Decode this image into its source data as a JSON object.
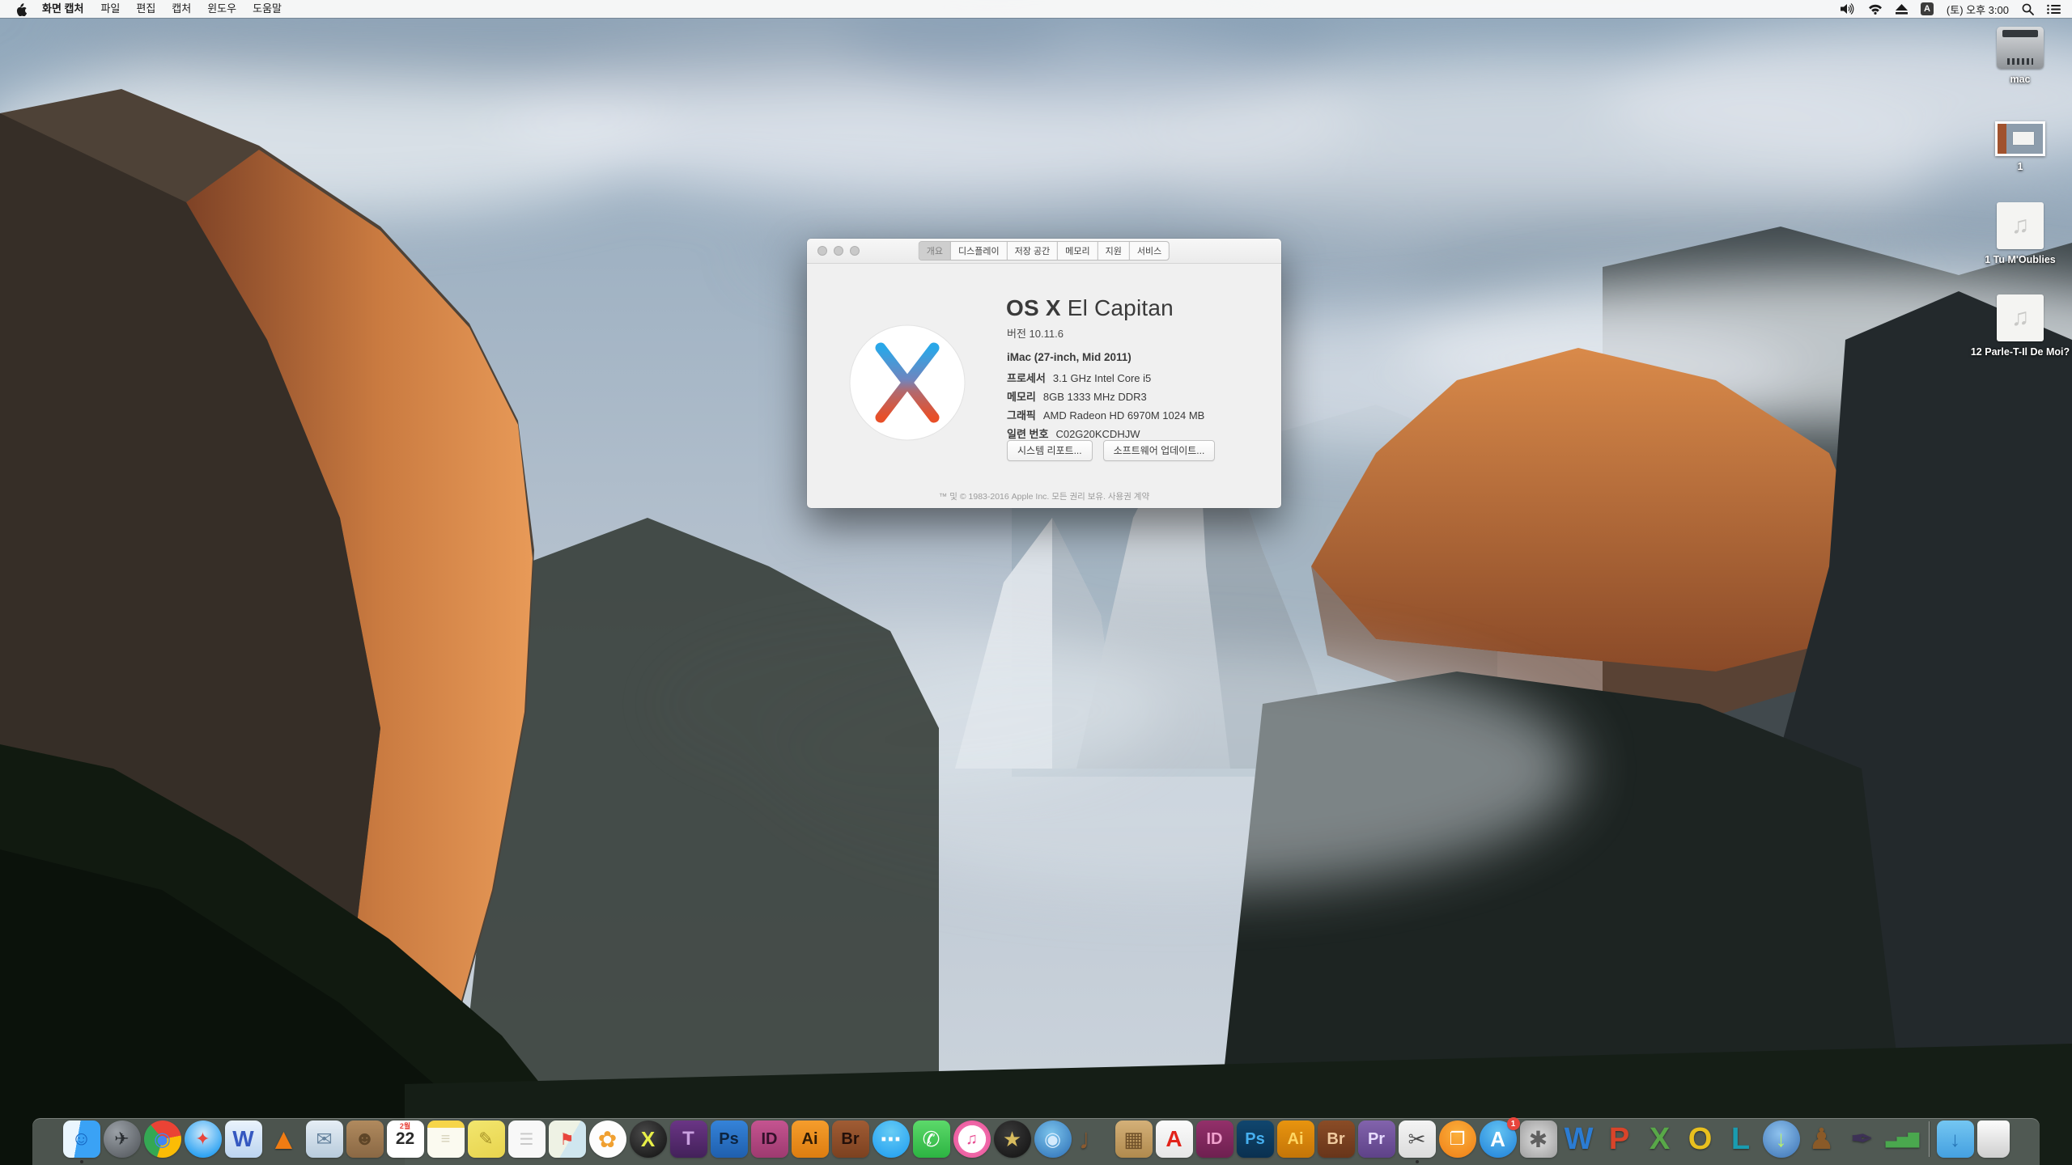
{
  "menu_bar": {
    "apple_icon": "apple-logo",
    "items": [
      {
        "id": "app",
        "label": "화면 캡처",
        "bold": true
      },
      {
        "id": "file",
        "label": "파일"
      },
      {
        "id": "edit",
        "label": "편집"
      },
      {
        "id": "capture",
        "label": "캡처"
      },
      {
        "id": "window",
        "label": "윈도우"
      },
      {
        "id": "help",
        "label": "도움말"
      }
    ],
    "status_icons_left": [
      "volume",
      "wifi",
      "eject"
    ],
    "input_source": "A",
    "clock": "(토) 오후 3:00",
    "status_icons_right": [
      "spotlight",
      "notification-center"
    ]
  },
  "about_window": {
    "tabs": [
      {
        "label": "개요",
        "selected": true
      },
      {
        "label": "디스플레이",
        "selected": false
      },
      {
        "label": "저장 공간",
        "selected": false
      },
      {
        "label": "메모리",
        "selected": false
      },
      {
        "label": "지원",
        "selected": false
      },
      {
        "label": "서비스",
        "selected": false
      }
    ],
    "title_bold": "OS X",
    "title_rest": " El Capitan",
    "version": "버전 10.11.6",
    "model": "iMac (27-inch, Mid 2011)",
    "specs": [
      {
        "label": "프로세서",
        "value": "3.1 GHz Intel Core i5"
      },
      {
        "label": "메모리",
        "value": "8GB 1333 MHz DDR3"
      },
      {
        "label": "그래픽",
        "value": "AMD Radeon HD 6970M 1024 MB"
      },
      {
        "label": "일련 번호",
        "value": "C02G20KCDHJW"
      }
    ],
    "buttons": [
      {
        "id": "system-report",
        "label": "시스템 리포트..."
      },
      {
        "id": "software-update",
        "label": "소프트웨어 업데이트..."
      }
    ],
    "footer": "™ 및 © 1983-2016 Apple Inc. 모든 권리 보유. 사용권 계약",
    "logo": "os-x-el-capitan-logo"
  },
  "desktop_icons": [
    {
      "name": "hard-drive-mac",
      "label": "mac",
      "type": "drive"
    },
    {
      "name": "screenshot-file-1",
      "label": "1",
      "type": "image"
    },
    {
      "name": "audio-file-tu-moublies",
      "label": "1 Tu M'Oublies",
      "type": "audio"
    },
    {
      "name": "audio-file-parle-t-il",
      "label": "12 Parle-T-Il De Moi?",
      "type": "audio"
    }
  ],
  "dock": {
    "items": [
      {
        "name": "finder",
        "glyph": "☺",
        "fg": "#1565c0",
        "bg": "linear-gradient(100deg,#eaf6fe 0 40%,#3aa2f5 40%)",
        "shape": "rounded",
        "fs": 24,
        "running": true
      },
      {
        "name": "launchpad",
        "glyph": "✈",
        "fg": "#2b2f33",
        "bg": "radial-gradient(circle at 35% 30%,#9aa0a6,#4d5156)",
        "shape": "circle",
        "fs": 22
      },
      {
        "name": "chrome",
        "glyph": "◉",
        "fg": "#4285f4",
        "bg": "conic-gradient(from -40deg,#ea4335 0 33%,#fbbc05 0 66%,#34a853 0)",
        "shape": "circle",
        "fs": 24
      },
      {
        "name": "safari",
        "glyph": "✦",
        "fg": "#e8453c",
        "bg": "radial-gradient(circle at 50% 35%,#cfeafc,#2fa3f2 75%)",
        "shape": "circle",
        "fs": 22
      },
      {
        "name": "iweb",
        "glyph": "W",
        "fg": "#3558c0",
        "bg": "linear-gradient(180deg,#eaf3fc,#bcd4f0)",
        "shape": "rounded",
        "fs": 28
      },
      {
        "name": "vlc",
        "glyph": "▲",
        "fg": "#f07c13",
        "bg": "transparent",
        "shape": "plain",
        "fs": 36
      },
      {
        "name": "mail",
        "glyph": "✉",
        "fg": "#64819c",
        "bg": "linear-gradient(180deg,#e6eef5,#b8cbdc)",
        "shape": "rounded",
        "fs": 24
      },
      {
        "name": "contacts",
        "glyph": "☻",
        "fg": "#5f4628",
        "bg": "linear-gradient(180deg,#b08a5e,#8a6844)",
        "shape": "rounded",
        "fs": 24
      },
      {
        "name": "calendar",
        "glyph": "22",
        "fg": "#2b2b2b",
        "bg": "#ffffff",
        "shape": "rounded",
        "fs": 21,
        "top": "2월"
      },
      {
        "name": "notes",
        "glyph": "≡",
        "fg": "#d6d2ba",
        "bg": "linear-gradient(180deg,#f6d54a 0 20%,#fbfaf0 20%)",
        "shape": "rounded",
        "fs": 20
      },
      {
        "name": "stickies",
        "glyph": "✎",
        "fg": "#a89428",
        "bg": "linear-gradient(160deg,#f2e66e,#e8d44e)",
        "shape": "rounded",
        "fs": 22
      },
      {
        "name": "reminders",
        "glyph": "☰",
        "fg": "#c9c9c9",
        "bg": "#f8f8f8",
        "shape": "rounded",
        "fs": 20
      },
      {
        "name": "maps",
        "glyph": "⚑",
        "fg": "#e8453c",
        "bg": "linear-gradient(120deg,#eef2e4 0 55%,#cfe6ef 55%)",
        "shape": "rounded",
        "fs": 20
      },
      {
        "name": "photos",
        "glyph": "✿",
        "fg": "#f0a030",
        "bg": "#fdfdfd",
        "shape": "circle",
        "fs": 28
      },
      {
        "name": "quarkxpress",
        "glyph": "X",
        "fg": "#e8f048",
        "bg": "radial-gradient(circle at 40% 35%,#4a4a4a,#0e0e0e)",
        "shape": "circle",
        "fs": 26
      },
      {
        "name": "toast-titanium",
        "glyph": "T",
        "fg": "#c9a0e0",
        "bg": "linear-gradient(180deg,#6a3585,#43215a)",
        "shape": "rounded",
        "fs": 24
      },
      {
        "name": "photoshop-cs5",
        "glyph": "Ps",
        "fg": "#0d2440",
        "bg": "linear-gradient(180deg,#3583d8,#1f5fae)",
        "shape": "rounded",
        "fs": 20
      },
      {
        "name": "indesign-cs5",
        "glyph": "ID",
        "fg": "#33102a",
        "bg": "linear-gradient(180deg,#c45490,#9e3a70)",
        "shape": "rounded",
        "fs": 20
      },
      {
        "name": "illustrator-cs5",
        "glyph": "Ai",
        "fg": "#301c05",
        "bg": "linear-gradient(180deg,#f59d2c,#dd7d10)",
        "shape": "rounded",
        "fs": 20
      },
      {
        "name": "bridge-cs5",
        "glyph": "Br",
        "fg": "#23100a",
        "bg": "linear-gradient(180deg,#a05c34,#7c4120)",
        "shape": "rounded",
        "fs": 20
      },
      {
        "name": "messages",
        "glyph": "⋯",
        "fg": "#ffffff",
        "bg": "radial-gradient(circle at 50% 30%,#66ccf5,#1d9bf0)",
        "shape": "circle",
        "fs": 26
      },
      {
        "name": "facetime",
        "glyph": "✆",
        "fg": "#ffffff",
        "bg": "linear-gradient(180deg,#5cd96a,#2cb442)",
        "shape": "rounded",
        "fs": 26
      },
      {
        "name": "itunes",
        "glyph": "♫",
        "fg": "#e84a90",
        "bg": "radial-gradient(circle,#ffffff 52%,#f06aaa 53%,#e84a90)",
        "shape": "circle",
        "fs": 20
      },
      {
        "name": "imovie",
        "glyph": "★",
        "fg": "#d8bc5e",
        "bg": "radial-gradient(circle at 40% 35%,#3a3a3a,#101010)",
        "shape": "circle",
        "fs": 26
      },
      {
        "name": "dvd-player",
        "glyph": "◉",
        "fg": "#d5eafc",
        "bg": "radial-gradient(circle at 45% 35%,#7cc4ec,#2a6cb4)",
        "shape": "circle",
        "fs": 24
      },
      {
        "name": "garageband",
        "glyph": "♩",
        "fg": "#8a5a30",
        "bg": "transparent",
        "shape": "plain",
        "fs": 36
      },
      {
        "name": "photo-board",
        "glyph": "▦",
        "fg": "#6e4f28",
        "bg": "linear-gradient(180deg,#d4b078,#b08a4e)",
        "shape": "rounded",
        "fs": 26
      },
      {
        "name": "acrobat-reader",
        "glyph": "A",
        "fg": "#e2231a",
        "bg": "linear-gradient(180deg,#fbfbfb,#e6e6e6)",
        "shape": "rounded",
        "fs": 28
      },
      {
        "name": "indesign-cs6",
        "glyph": "ID",
        "fg": "#f0a0cc",
        "bg": "linear-gradient(180deg,#93306a,#6e2050)",
        "shape": "rounded",
        "fs": 20
      },
      {
        "name": "photoshop-cs6",
        "glyph": "Ps",
        "fg": "#46b0f0",
        "bg": "linear-gradient(180deg,#10466e,#0a3050)",
        "shape": "rounded",
        "fs": 20
      },
      {
        "name": "illustrator-cs6",
        "glyph": "Ai",
        "fg": "#ffd763",
        "bg": "linear-gradient(180deg,#e8940f,#c47508)",
        "shape": "rounded",
        "fs": 20
      },
      {
        "name": "bridge-cs6",
        "glyph": "Br",
        "fg": "#f0ca9e",
        "bg": "linear-gradient(180deg,#8a4c26,#68351a)",
        "shape": "rounded",
        "fs": 20
      },
      {
        "name": "premiere-cs6",
        "glyph": "Pr",
        "fg": "#e8dcff",
        "bg": "linear-gradient(180deg,#8263ac,#5e4288)",
        "shape": "rounded",
        "fs": 20
      },
      {
        "name": "grab-screen-capture",
        "glyph": "✂",
        "fg": "#4a4a4a",
        "bg": "linear-gradient(180deg,#f4f4f4,#dcdcdc)",
        "shape": "rounded",
        "fs": 26,
        "running": true
      },
      {
        "name": "ibooks",
        "glyph": "❐",
        "fg": "#ffffff",
        "bg": "radial-gradient(circle at 50% 35%,#fbb03c,#ef7d15)",
        "shape": "circle",
        "fs": 22
      },
      {
        "name": "app-store",
        "glyph": "A",
        "fg": "#ffffff",
        "bg": "radial-gradient(circle at 50% 30%,#62c2f2,#1f80d8)",
        "shape": "circle",
        "fs": 26,
        "badge": "1"
      },
      {
        "name": "system-preferences",
        "glyph": "✱",
        "fg": "#606060",
        "bg": "radial-gradient(circle,#e0e0e0,#9e9e9e)",
        "shape": "rounded",
        "fs": 28
      },
      {
        "name": "word-2011",
        "glyph": "W",
        "fg": "#2b7cd3",
        "bg": "transparent",
        "shape": "plain",
        "fs": 38
      },
      {
        "name": "powerpoint-2011",
        "glyph": "P",
        "fg": "#d8442a",
        "bg": "transparent",
        "shape": "plain",
        "fs": 38
      },
      {
        "name": "excel-2011",
        "glyph": "X",
        "fg": "#58a848",
        "bg": "transparent",
        "shape": "plain",
        "fs": 38
      },
      {
        "name": "outlook-2011",
        "glyph": "O",
        "fg": "#e8c01e",
        "bg": "transparent",
        "shape": "plain",
        "fs": 38
      },
      {
        "name": "lync-2011",
        "glyph": "L",
        "fg": "#1a9cb0",
        "bg": "transparent",
        "shape": "plain",
        "fs": 38
      },
      {
        "name": "downloader",
        "glyph": "↓",
        "fg": "#b8f06a",
        "bg": "radial-gradient(circle at 45% 35%,#8ec2ee,#3a70b2)",
        "shape": "circle",
        "fs": 28
      },
      {
        "name": "keynote",
        "glyph": "♟",
        "fg": "#8a5a28",
        "bg": "transparent",
        "shape": "plain",
        "fs": 36
      },
      {
        "name": "pages",
        "glyph": "✒",
        "fg": "#3d3156",
        "bg": "transparent",
        "shape": "plain",
        "fs": 34
      },
      {
        "name": "numbers",
        "glyph": "▃▅▇",
        "fg": "#4aa84e",
        "bg": "transparent",
        "shape": "plain",
        "fs": 18
      },
      {
        "separator": true
      },
      {
        "name": "downloads-folder",
        "glyph": "↓",
        "fg": "#2a78b8",
        "bg": "linear-gradient(180deg,#74c6f2,#44a0e0)",
        "shape": "rounded",
        "fs": 26
      },
      {
        "name": "trash",
        "glyph": "",
        "fg": "#b8b8b8",
        "bg": "linear-gradient(180deg,#fcfcfc,#cfcfcf)",
        "shape": "trash",
        "fs": 20
      }
    ]
  },
  "colors": {
    "menubar_bg": "#f9f9f9",
    "dock_bg_rgba": "rgba(124,133,128,0.58)",
    "badge_red": "#e8453c",
    "logo_blue": "#2aa7e8",
    "logo_red": "#e84f28",
    "window_bg": "#f0f0f0",
    "selected_tab_bg": "#cecece"
  }
}
